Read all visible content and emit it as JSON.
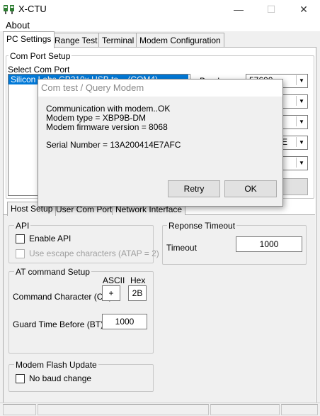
{
  "window": {
    "title": "X-CTU",
    "minimize_glyph": "—",
    "maximize_glyph": "☐",
    "close_glyph": "✕"
  },
  "menu": {
    "items": [
      {
        "label": "About"
      }
    ]
  },
  "tabs": [
    {
      "label": "PC Settings",
      "selected": true
    },
    {
      "label": "Range Test",
      "selected": false
    },
    {
      "label": "Terminal",
      "selected": false
    },
    {
      "label": "Modem Configuration",
      "selected": false
    }
  ],
  "com_port_setup": {
    "group_label": "Com Port Setup",
    "select_label": "Select Com Port",
    "selected_port": "Silicon Labs CP210x USB to... (COM4)",
    "baud_label": "Baud",
    "baud_value": "57600",
    "partial_value": "E"
  },
  "sub_tabs": [
    {
      "label": "Host Setup",
      "selected": true
    },
    {
      "label": "User Com Ports",
      "selected": false
    },
    {
      "label": "Network Interface",
      "selected": false
    }
  ],
  "api": {
    "group_label": "API",
    "enable_label": "Enable API",
    "escape_label": "Use escape characters (ATAP = 2)"
  },
  "at_setup": {
    "group_label": "AT command Setup",
    "ascii_header": "ASCII",
    "hex_header": "Hex",
    "command_char_label": "Command Character (CC)",
    "ascii_value": "+",
    "hex_value": "2B",
    "guard_label": "Guard Time Before (BT)",
    "guard_value": "1000"
  },
  "response": {
    "group_label": "Reponse Timeout",
    "timeout_label": "Timeout",
    "timeout_value": "1000"
  },
  "flash": {
    "group_label": "Modem Flash Update",
    "no_baud_label": "No baud change"
  },
  "dialog": {
    "title": "Com test / Query Modem",
    "line1": "Communication with modem..OK",
    "line2": "Modem type = XBP9B-DM",
    "line3": "Modem firmware version = 8068",
    "line4": "Serial Number = 13A200414E7AFC",
    "retry_label": "Retry",
    "ok_label": "OK"
  },
  "colors": {
    "selection": "#0078d7",
    "dialog_title_text": "#8a8a8a"
  }
}
